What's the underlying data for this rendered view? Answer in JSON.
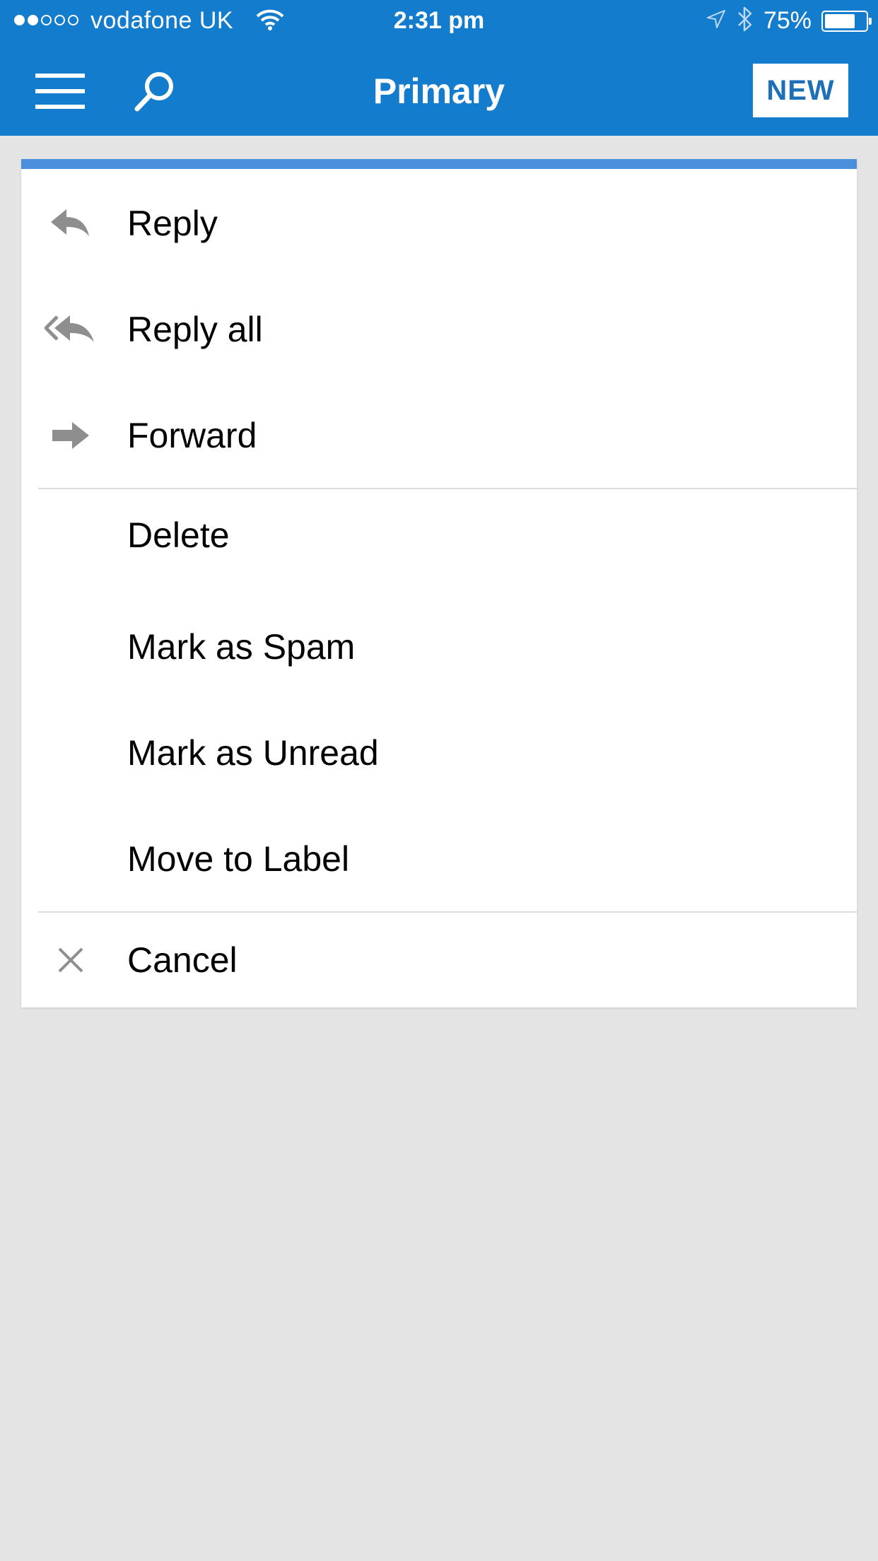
{
  "status_bar": {
    "carrier": "vodafone UK",
    "time": "2:31 pm",
    "battery_percent": "75%",
    "battery_level": 0.75,
    "signal_bars_filled": 2,
    "signal_bars_total": 5,
    "icons": [
      "wifi-icon",
      "location-arrow-icon",
      "bluetooth-icon",
      "battery-icon"
    ]
  },
  "toolbar": {
    "title": "Primary",
    "new_label": "NEW",
    "icons": [
      "hamburger-menu-icon",
      "search-icon"
    ]
  },
  "action_sheet": {
    "items": [
      {
        "label": "Reply",
        "icon": "reply-icon"
      },
      {
        "label": "Reply all",
        "icon": "reply-all-icon"
      },
      {
        "label": "Forward",
        "icon": "forward-icon"
      },
      {
        "label": "Delete",
        "icon": ""
      },
      {
        "label": "Mark as Spam",
        "icon": ""
      },
      {
        "label": "Mark as Unread",
        "icon": ""
      },
      {
        "label": "Move to Label",
        "icon": ""
      },
      {
        "label": "Cancel",
        "icon": "close-icon"
      }
    ]
  },
  "colors": {
    "header_blue": "#137ccd",
    "accent_bar": "#4a8fdc",
    "background": "#e4e4e4",
    "icon_gray": "#8e8e8e"
  }
}
